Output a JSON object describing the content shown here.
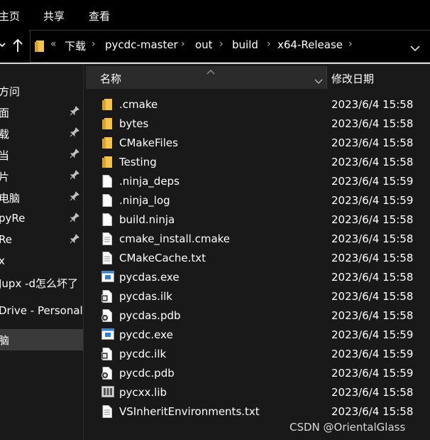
{
  "ribbon": {
    "tabs": [
      "主页",
      "共享",
      "查看"
    ]
  },
  "address": {
    "overflow": "«",
    "crumbs": [
      "下载",
      "pycdc-master",
      "out",
      "build",
      "x64-Release"
    ]
  },
  "nav": {
    "items": [
      {
        "label": "方问",
        "pinned": false
      },
      {
        "label": "面",
        "pinned": true
      },
      {
        "label": "载",
        "pinned": true
      },
      {
        "label": "当",
        "pinned": true
      },
      {
        "label": "片",
        "pinned": true
      },
      {
        "label": "电脑",
        "pinned": true
      },
      {
        "label": "pyRe",
        "pinned": true
      },
      {
        "label": "Re",
        "pinned": true
      },
      {
        "label": "x",
        "pinned": false
      },
      {
        "label": "Jupx -d怎么坏了",
        "pinned": false
      },
      {
        "label": "Drive - Personal",
        "pinned": false
      },
      {
        "label": "脑",
        "pinned": false,
        "selected": true
      }
    ]
  },
  "columns": {
    "name": "名称",
    "date": "修改日期"
  },
  "files": [
    {
      "name": ".cmake",
      "date": "2023/6/4 15:58",
      "icon": "folder-icon"
    },
    {
      "name": "bytes",
      "date": "2023/6/4 15:58",
      "icon": "folder-icon"
    },
    {
      "name": "CMakeFiles",
      "date": "2023/6/4 15:58",
      "icon": "folder-icon"
    },
    {
      "name": "Testing",
      "date": "2023/6/4 15:58",
      "icon": "folder-icon"
    },
    {
      "name": ".ninja_deps",
      "date": "2023/6/4 15:59",
      "icon": "blank-file-icon"
    },
    {
      "name": ".ninja_log",
      "date": "2023/6/4 15:59",
      "icon": "blank-file-icon"
    },
    {
      "name": "build.ninja",
      "date": "2023/6/4 15:58",
      "icon": "blank-file-icon"
    },
    {
      "name": "cmake_install.cmake",
      "date": "2023/6/4 15:58",
      "icon": "text-file-icon"
    },
    {
      "name": "CMakeCache.txt",
      "date": "2023/6/4 15:58",
      "icon": "text-file-icon"
    },
    {
      "name": "pycdas.exe",
      "date": "2023/6/4 15:58",
      "icon": "exe-icon"
    },
    {
      "name": "pycdas.ilk",
      "date": "2023/6/4 15:58",
      "icon": "ilk-file-icon"
    },
    {
      "name": "pycdas.pdb",
      "date": "2023/6/4 15:58",
      "icon": "pdb-file-icon"
    },
    {
      "name": "pycdc.exe",
      "date": "2023/6/4 15:59",
      "icon": "exe-icon"
    },
    {
      "name": "pycdc.ilk",
      "date": "2023/6/4 15:59",
      "icon": "ilk-file-icon"
    },
    {
      "name": "pycdc.pdb",
      "date": "2023/6/4 15:59",
      "icon": "pdb-file-icon"
    },
    {
      "name": "pycxx.lib",
      "date": "2023/6/4 15:58",
      "icon": "lib-file-icon"
    },
    {
      "name": "VSInheritEnvironments.txt",
      "date": "2023/6/4 15:58",
      "icon": "text-file-icon"
    }
  ],
  "watermark": "CSDN @OrientalGlass",
  "colors": {
    "background": "#191919",
    "folder": "#f4c44e",
    "accent": "#2f7fd6"
  }
}
